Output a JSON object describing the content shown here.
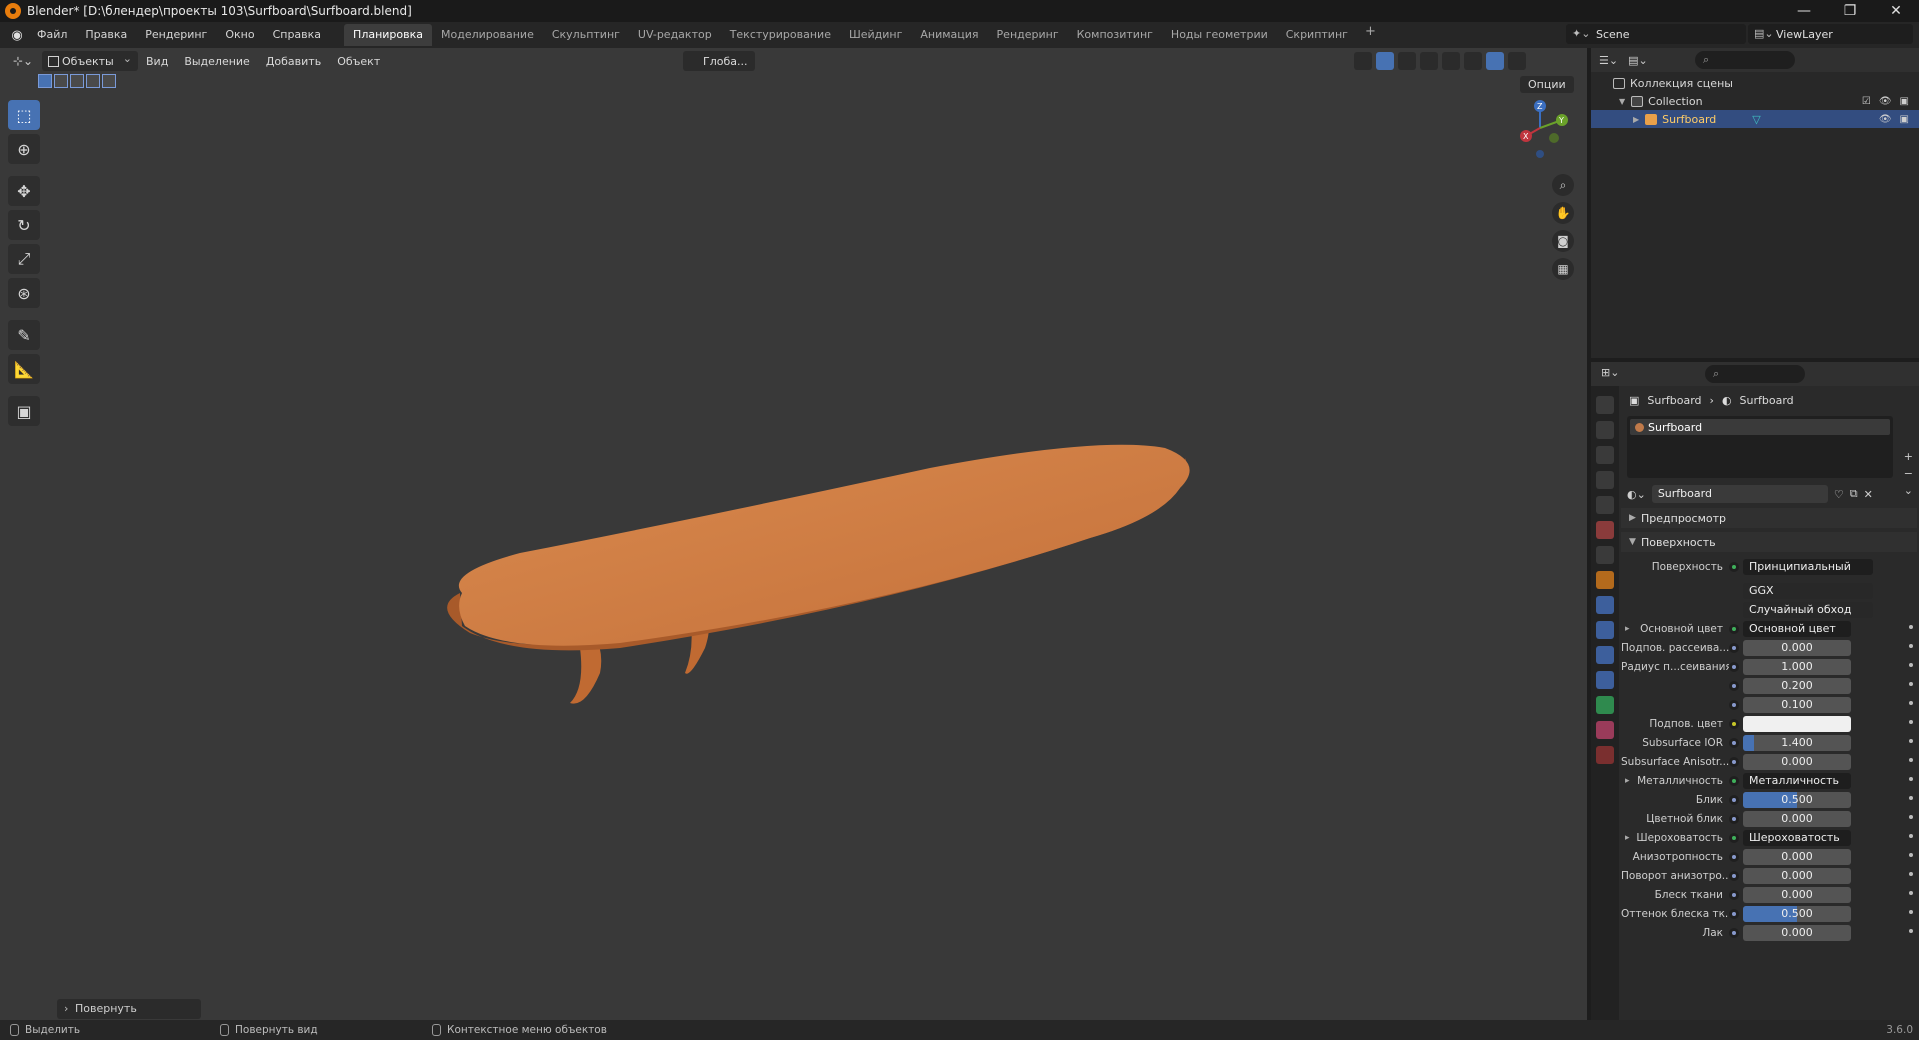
{
  "window": {
    "title": "Blender* [D:\\блендер\\проекты 103\\Surfboard\\Surfboard.blend]",
    "minimize": "—",
    "maximize": "❐",
    "close": "✕"
  },
  "menu": [
    "Файл",
    "Правка",
    "Рендеринг",
    "Окно",
    "Справка"
  ],
  "workspaces": {
    "active_index": 0,
    "tabs": [
      "Планировка",
      "Моделирование",
      "Скульптинг",
      "UV-редактор",
      "Текстурирование",
      "Шейдинг",
      "Анимация",
      "Рендеринг",
      "Композитинг",
      "Ноды геометрии",
      "Скриптинг"
    ],
    "add": "+"
  },
  "scene": {
    "name": "Scene",
    "view_layer": "ViewLayer"
  },
  "viewport": {
    "mode": "Объекты",
    "menus": [
      "Вид",
      "Выделение",
      "Добавить",
      "Объект"
    ],
    "transform_orientation": "Глоба...",
    "options": "Опции",
    "last_operator": "Повернуть",
    "gizmo": {
      "z": "Z",
      "y": "Y",
      "x": "X"
    },
    "board_colors": {
      "top": "#d98a4e",
      "mid": "#c4703a",
      "edge": "#a85a2a",
      "fin": "#c06a32"
    }
  },
  "outliner": {
    "search_placeholder": "⌕",
    "rows": [
      {
        "label": "Коллекция сцены",
        "icon": "scene-collection-icon"
      },
      {
        "label": "Collection",
        "icon": "collection-icon"
      },
      {
        "label": "Surfboard",
        "icon": "mesh-object-icon",
        "selected": true
      }
    ]
  },
  "properties": {
    "breadcrumb": {
      "object": "Surfboard",
      "material": "Surfboard"
    },
    "slot_name": "Surfboard",
    "material_name": "Surfboard",
    "panels": {
      "preview": "Предпросмотр",
      "surface": "Поверхность"
    },
    "surface_label": "Поверхность",
    "surface_value": "Принципиальный BSDF",
    "distribution": "GGX",
    "subsurface_method": "Случайный обход",
    "rows": [
      {
        "label": "Основной цвет",
        "value": "Основной цвет",
        "kind": "link",
        "expand": true
      },
      {
        "label": "Подпов. рассеива...",
        "value": "0.000",
        "kind": "num"
      },
      {
        "label": "Радиус п...сеивания",
        "value": "1.000",
        "kind": "num"
      },
      {
        "label": "",
        "value": "0.200",
        "kind": "num"
      },
      {
        "label": "",
        "value": "0.100",
        "kind": "num"
      },
      {
        "label": "Подпов. цвет",
        "value": "",
        "kind": "color",
        "dot": "yel"
      },
      {
        "label": "Subsurface IOR",
        "value": "1.400",
        "kind": "slider",
        "fill": 0.1
      },
      {
        "label": "Subsurface Anisotr...",
        "value": "0.000",
        "kind": "num"
      },
      {
        "label": "Металличность",
        "value": "Металличность",
        "kind": "link",
        "expand": true
      },
      {
        "label": "Блик",
        "value": "0.500",
        "kind": "slider",
        "fill": 0.5
      },
      {
        "label": "Цветной блик",
        "value": "0.000",
        "kind": "num"
      },
      {
        "label": "Шероховатость",
        "value": "Шероховатость",
        "kind": "link",
        "expand": true
      },
      {
        "label": "Анизотропность",
        "value": "0.000",
        "kind": "num"
      },
      {
        "label": "Поворот анизотро...",
        "value": "0.000",
        "kind": "num"
      },
      {
        "label": "Блеск ткани",
        "value": "0.000",
        "kind": "num"
      },
      {
        "label": "Оттенок блеска тк...",
        "value": "0.500",
        "kind": "slider",
        "fill": 0.5
      },
      {
        "label": "Лак",
        "value": "0.000",
        "kind": "num"
      }
    ]
  },
  "status": {
    "select": "Выделить",
    "rotate_view": "Повернуть вид",
    "context_menu": "Контекстное меню объектов",
    "version": "3.6.0"
  }
}
